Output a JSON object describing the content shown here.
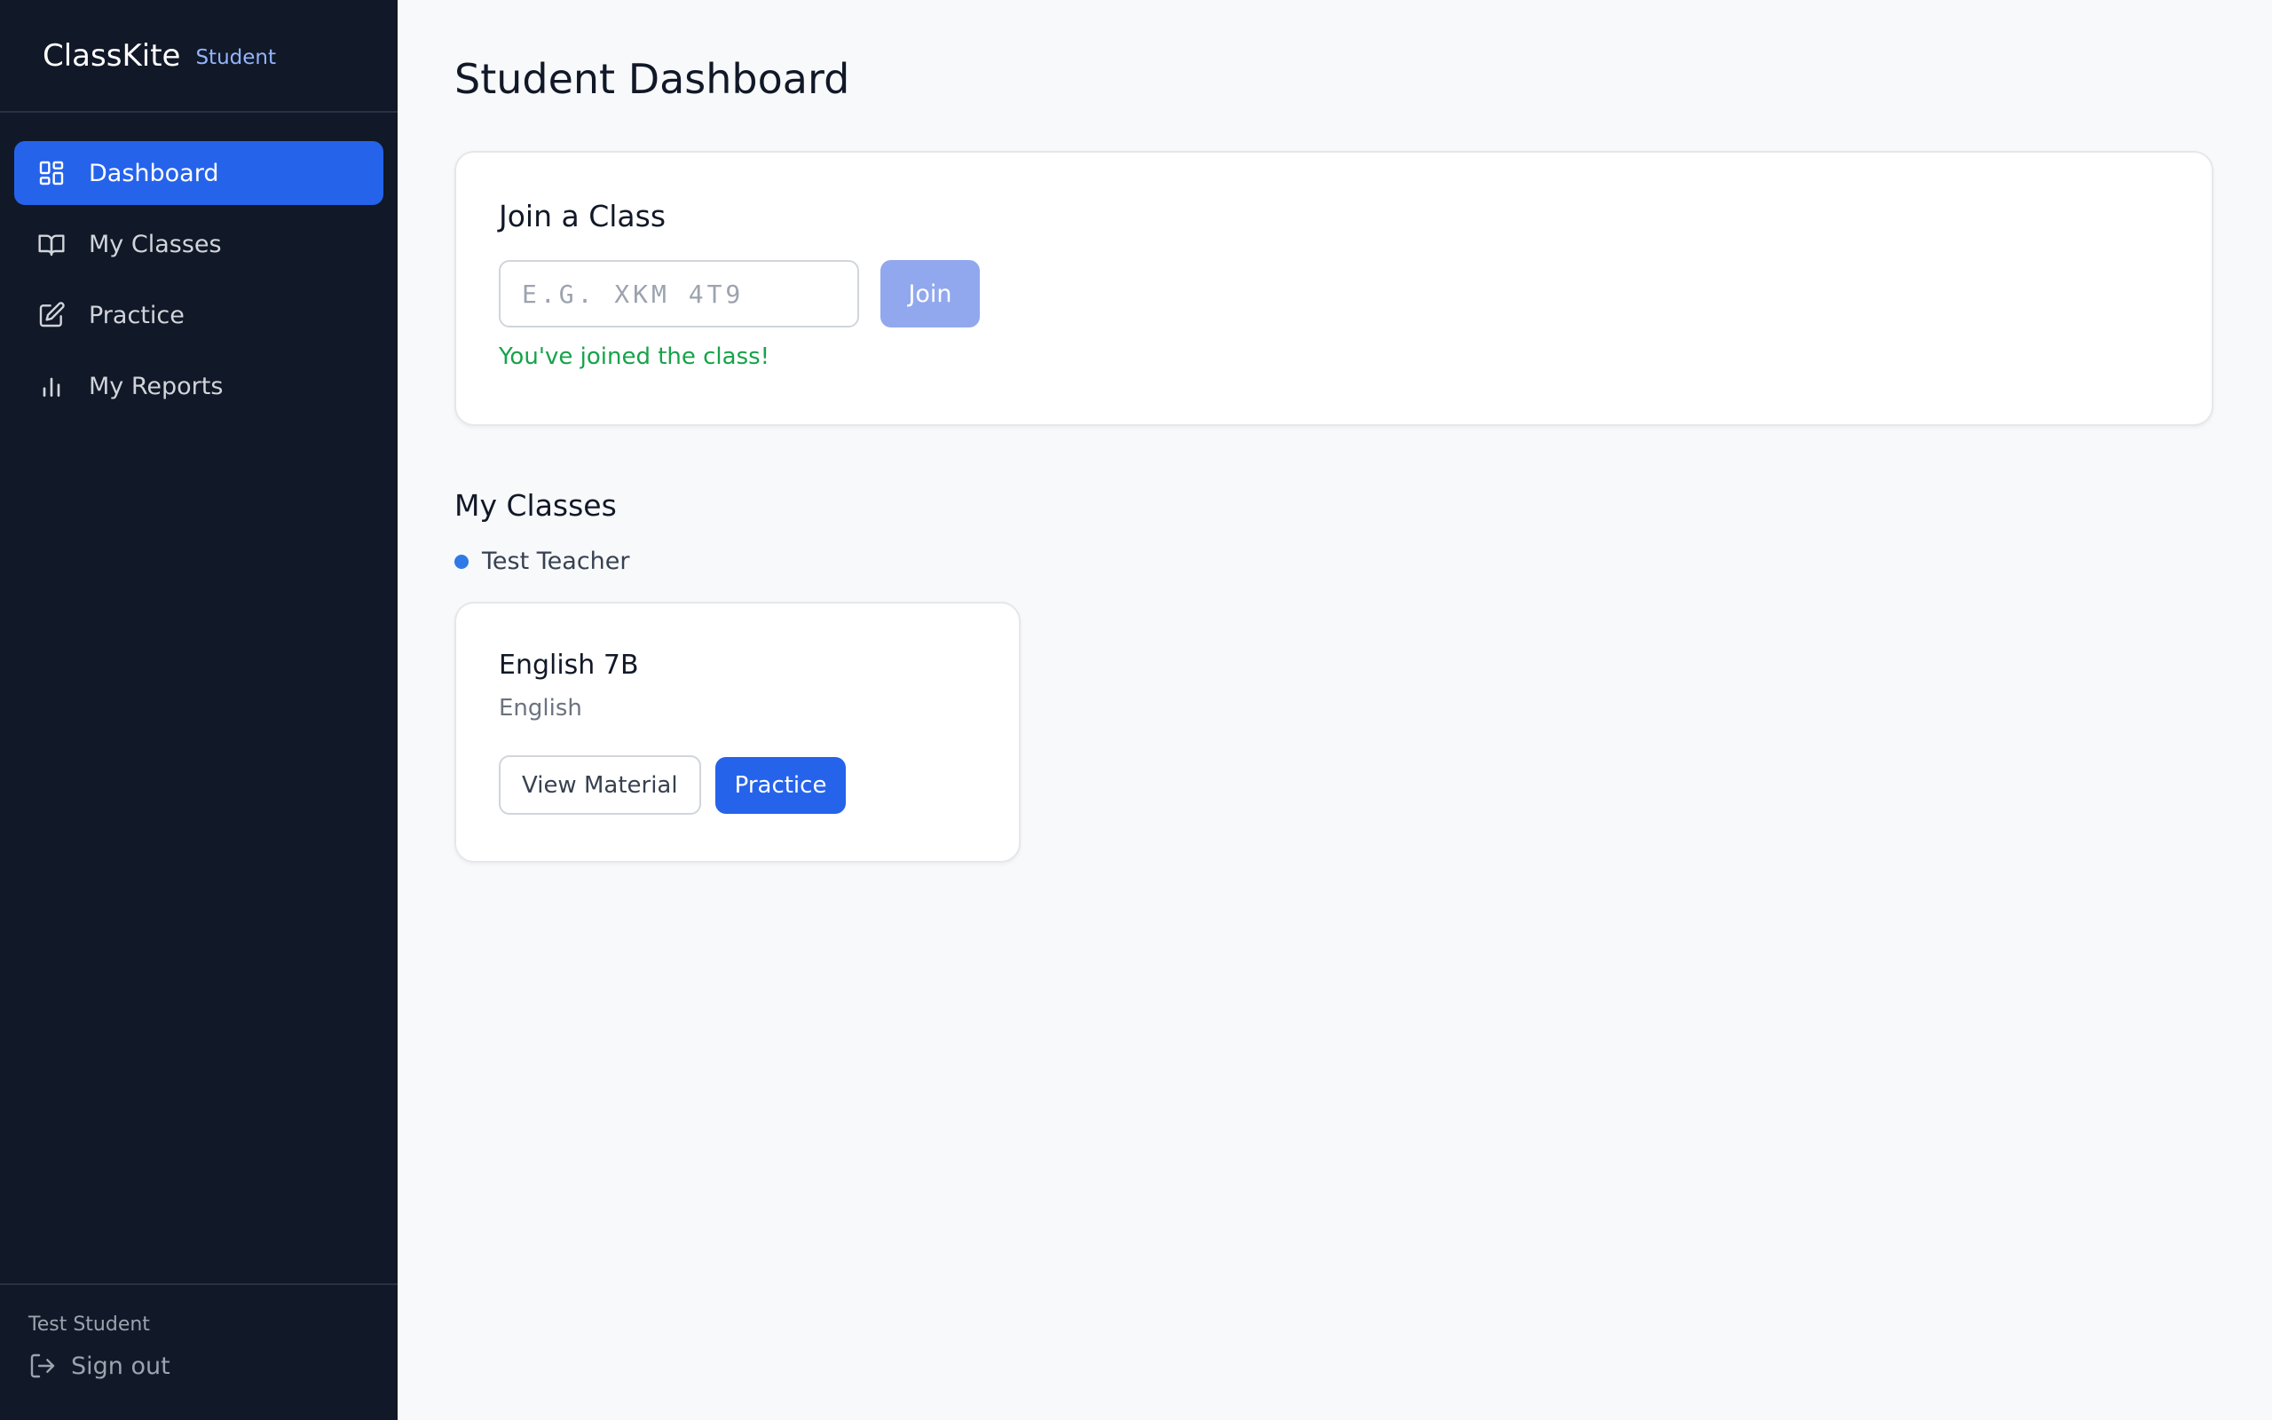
{
  "brand": {
    "name": "ClassKite",
    "role": "Student"
  },
  "sidebar": {
    "items": [
      {
        "label": "Dashboard",
        "icon": "dashboard-icon",
        "active": true
      },
      {
        "label": "My Classes",
        "icon": "book-icon",
        "active": false
      },
      {
        "label": "Practice",
        "icon": "edit-icon",
        "active": false
      },
      {
        "label": "My Reports",
        "icon": "bar-chart-icon",
        "active": false
      }
    ],
    "user_name": "Test Student",
    "signout_label": "Sign out"
  },
  "main": {
    "title": "Student Dashboard",
    "join": {
      "title": "Join a Class",
      "placeholder": "E.G. XKM 4T9",
      "value": "",
      "button_label": "Join",
      "success_message": "You've joined the class!"
    },
    "classes_section": {
      "title": "My Classes",
      "teacher": "Test Teacher",
      "classes": [
        {
          "name": "English 7B",
          "subject": "English",
          "view_label": "View Material",
          "practice_label": "Practice"
        }
      ]
    }
  },
  "colors": {
    "sidebar_bg": "#111827",
    "accent": "#2563eb",
    "join_disabled": "#91a8ee",
    "success": "#16a34a",
    "teacher_dot": "#2f7ae6"
  }
}
